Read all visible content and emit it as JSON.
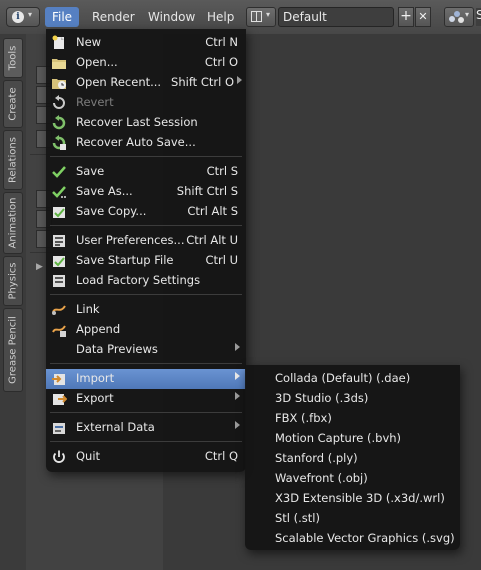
{
  "topbar": {
    "menus": [
      "File",
      "Render",
      "Window",
      "Help"
    ],
    "layout_name": "Default",
    "add_symbol": "+",
    "remove_symbol": "✕",
    "truncated_label": "S",
    "info_icon": "info-icon",
    "accent": "#5680c2"
  },
  "left_tabs": [
    "Tools",
    "Create",
    "Relations",
    "Animation",
    "Physics",
    "Grease Pencil"
  ],
  "file_menu": {
    "items": [
      {
        "label": "New",
        "shortcut": "Ctrl N",
        "icon": "new-file-icon"
      },
      {
        "label": "Open...",
        "shortcut": "Ctrl O",
        "icon": "folder-icon"
      },
      {
        "label": "Open Recent...",
        "shortcut": "Shift Ctrl O",
        "icon": "open-recent-icon",
        "submenu": true
      },
      {
        "label": "Revert",
        "shortcut": "",
        "icon": "revert-icon",
        "disabled": true
      },
      {
        "label": "Recover Last Session",
        "shortcut": "",
        "icon": "recover-icon"
      },
      {
        "label": "Recover Auto Save...",
        "shortcut": "",
        "icon": "recover-auto-icon"
      },
      {
        "label": "Save",
        "shortcut": "Ctrl S",
        "icon": "checkmark-icon"
      },
      {
        "label": "Save As...",
        "shortcut": "Shift Ctrl S",
        "icon": "checkmark-dots-icon"
      },
      {
        "label": "Save Copy...",
        "shortcut": "Ctrl Alt S",
        "icon": "save-copy-icon"
      },
      {
        "label": "User Preferences...",
        "shortcut": "Ctrl Alt U",
        "icon": "preferences-icon"
      },
      {
        "label": "Save Startup File",
        "shortcut": "Ctrl U",
        "icon": "save-startup-icon"
      },
      {
        "label": "Load Factory Settings",
        "shortcut": "",
        "icon": "factory-settings-icon"
      },
      {
        "label": "Link",
        "shortcut": "",
        "icon": "link-icon"
      },
      {
        "label": "Append",
        "shortcut": "",
        "icon": "append-icon"
      },
      {
        "label": "Data Previews",
        "shortcut": "",
        "icon": "",
        "submenu": true
      },
      {
        "label": "Import",
        "shortcut": "",
        "icon": "import-icon",
        "submenu": true,
        "highlighted": true
      },
      {
        "label": "Export",
        "shortcut": "",
        "icon": "export-icon",
        "submenu": true
      },
      {
        "label": "External Data",
        "shortcut": "",
        "icon": "external-data-icon",
        "submenu": true
      },
      {
        "label": "Quit",
        "shortcut": "Ctrl Q",
        "icon": "power-icon"
      }
    ]
  },
  "import_submenu": {
    "items": [
      "Collada (Default) (.dae)",
      "3D Studio (.3ds)",
      "FBX (.fbx)",
      "Motion Capture (.bvh)",
      "Stanford (.ply)",
      "Wavefront (.obj)",
      "X3D Extensible 3D (.x3d/.wrl)",
      "Stl (.stl)",
      "Scalable Vector Graphics (.svg)"
    ]
  }
}
